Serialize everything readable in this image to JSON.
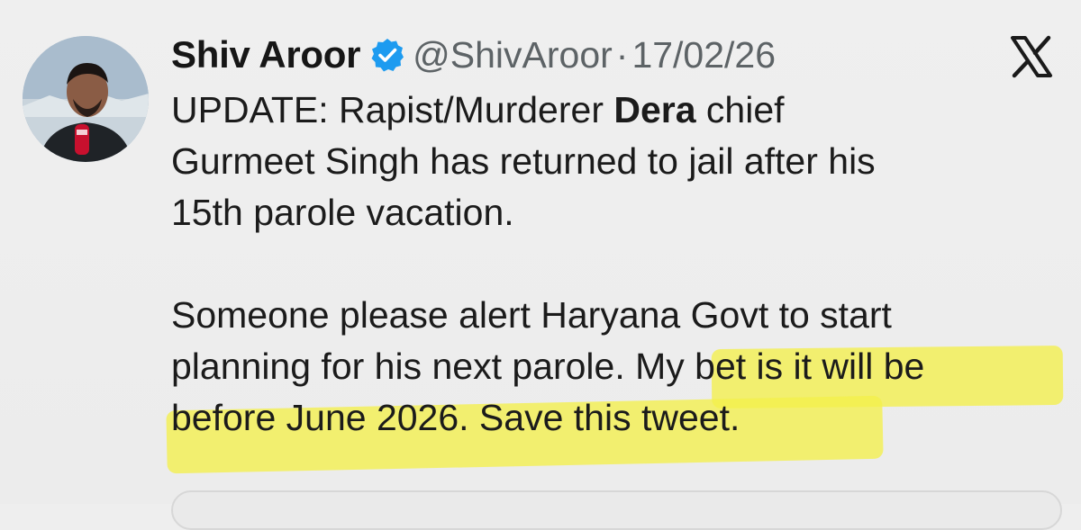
{
  "tweet": {
    "display_name": "Shiv Aroor",
    "handle": "@ShivAroor",
    "separator": "·",
    "date": "17/02/26",
    "lines": {
      "line1_pre": "UPDATE: Rapist/Murderer ",
      "line1_bold": "Dera",
      "line1_post": " chief",
      "line2": "Gurmeet Singh has returned to jail after his",
      "line3": "15th parole vacation.",
      "line4": "Someone please alert Haryana Govt to start",
      "line5_pre": "planning for his next parole. ",
      "line5_hl": "My bet is it will be",
      "line6": "before June 2026. Save this tweet."
    }
  },
  "icons": {
    "verified": "verified-badge-icon",
    "platform": "x-logo-icon"
  },
  "colors": {
    "background": "#eeeeee",
    "verified_blue": "#1d9bf0",
    "highlight": "#f3f04b",
    "secondary_text": "#5d6366"
  }
}
